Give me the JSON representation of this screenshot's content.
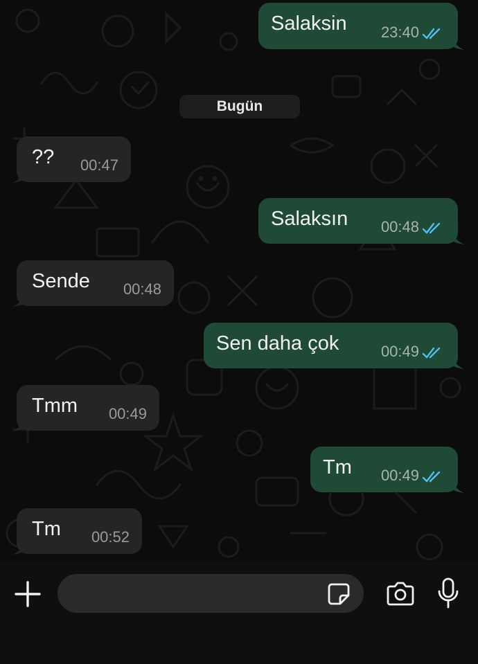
{
  "date_divider": "Bugün",
  "messages": [
    {
      "direction": "out",
      "text": "Salaksin",
      "time": "23:40",
      "status": "read"
    },
    {
      "direction": "in",
      "text": "??",
      "time": "00:47"
    },
    {
      "direction": "out",
      "text": "Salaksın",
      "time": "00:48",
      "status": "read"
    },
    {
      "direction": "in",
      "text": "Sende",
      "time": "00:48"
    },
    {
      "direction": "out",
      "text": "Sen daha çok",
      "time": "00:49",
      "status": "read"
    },
    {
      "direction": "in",
      "text": "Tmm",
      "time": "00:49"
    },
    {
      "direction": "out",
      "text": "Tm",
      "time": "00:49",
      "status": "read"
    },
    {
      "direction": "in",
      "text": "Tm",
      "time": "00:52"
    }
  ],
  "composer": {
    "placeholder": "",
    "icons": [
      "plus-icon",
      "sticker-icon",
      "camera-icon",
      "microphone-icon"
    ]
  },
  "colors": {
    "outgoing_bubble": "#1f4a35",
    "incoming_bubble": "#252525",
    "read_ticks": "#53bdeb",
    "background": "#0c0c0c"
  }
}
